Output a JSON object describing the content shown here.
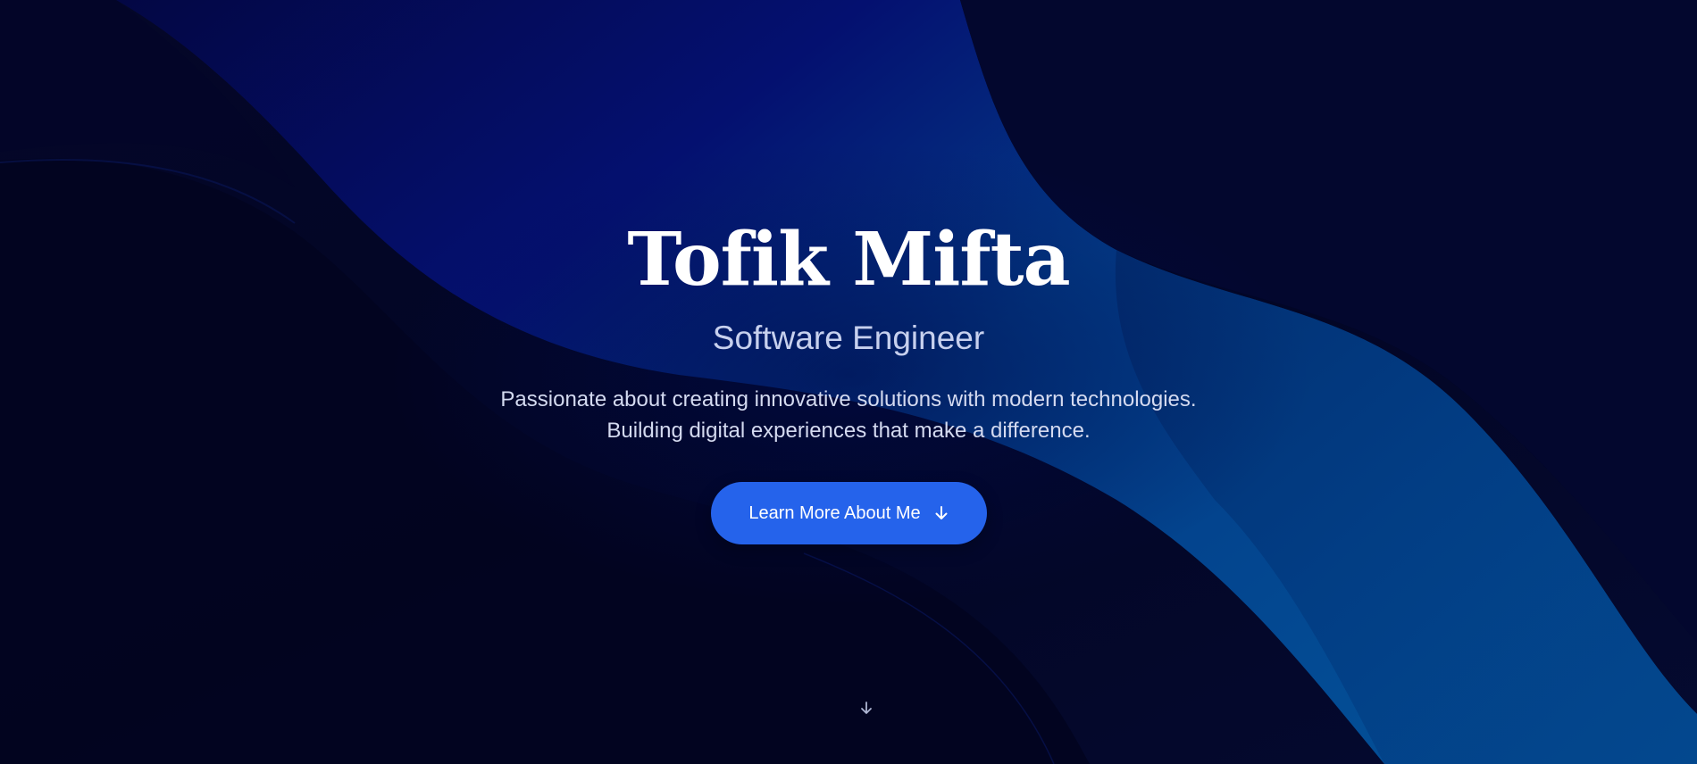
{
  "hero": {
    "name": "Tofik Mifta",
    "role": "Software Engineer",
    "description_lines": [
      "Passionate about creating innovative solutions with modern technologies.",
      "Building digital experiences that make a difference."
    ],
    "cta_label": "Learn More About Me",
    "cta_icon": "arrow-down-icon",
    "scroll_icon": "arrow-down-icon"
  },
  "colors": {
    "background": "#03052a",
    "accent_button": "#2563eb",
    "wave_blue": "#023b7e",
    "title_text": "#ffffff",
    "subtitle_text": "#c7d0ee"
  }
}
